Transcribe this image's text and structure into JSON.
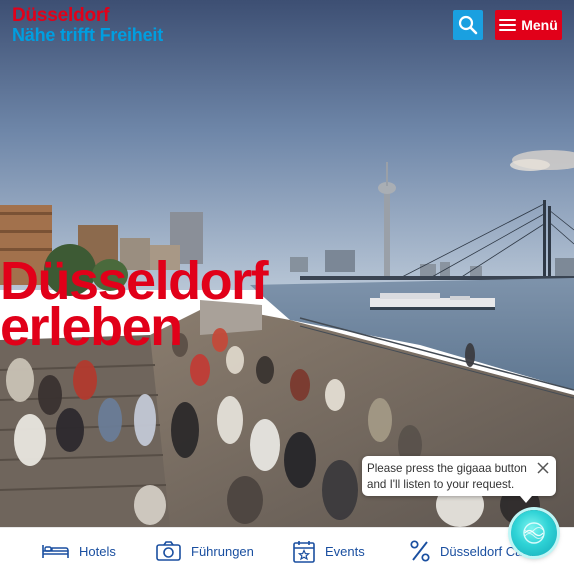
{
  "header": {
    "logo_line1": "Düsseldorf",
    "logo_line2": "Nähe trifft Freiheit",
    "search_icon": "search-icon",
    "menu_label": "Menü",
    "menu_icon": "hamburger-icon"
  },
  "hero": {
    "headline_line1": "Düsseldorf",
    "headline_line2": "erleben"
  },
  "chat": {
    "message": "Please press the gigaaa button and I'll listen to your request.",
    "close_icon": "close-icon"
  },
  "bottom_nav": [
    {
      "label": "Hotels",
      "icon": "bed-icon"
    },
    {
      "label": "Führungen",
      "icon": "camera-icon"
    },
    {
      "label": "Events",
      "icon": "calendar-star-icon"
    },
    {
      "label": "Düsseldorf Card",
      "icon": "percent-icon"
    }
  ],
  "assistant": {
    "icon": "gigaaa-assistant-icon"
  },
  "colors": {
    "brand_red": "#e10019",
    "brand_blue": "#009ee0",
    "nav_blue": "#1a4fa0",
    "assistant_teal": "#2fd3d6"
  }
}
